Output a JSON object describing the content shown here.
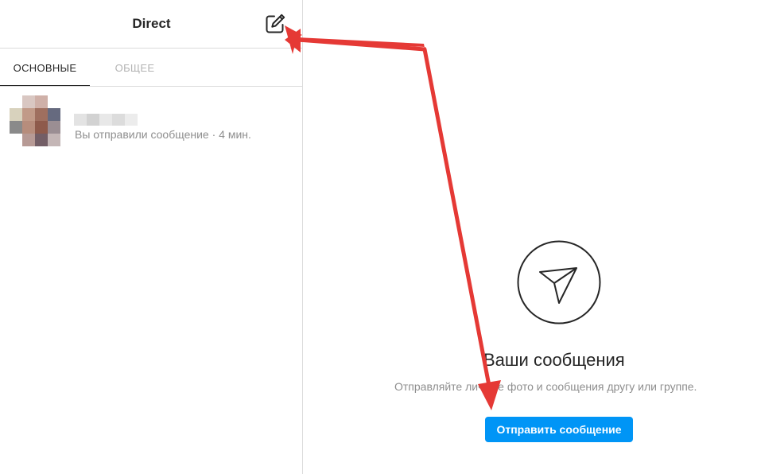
{
  "header": {
    "title": "Direct",
    "compose_icon": "new-message-icon"
  },
  "tabs": [
    {
      "label": "ОСНОВНЫЕ",
      "active": true
    },
    {
      "label": "ОБЩЕЕ",
      "active": false
    }
  ],
  "threads": [
    {
      "preview": "Вы отправили сообщение · 4 мин."
    }
  ],
  "empty_state": {
    "icon": "paper-plane-icon",
    "title": "Ваши сообщения",
    "subtitle": "Отправляйте личные фото и сообщения другу или группе.",
    "button_label": "Отправить сообщение"
  },
  "colors": {
    "accent": "#0095f6",
    "annotation_arrow": "#e53935",
    "border": "#dbdbdb",
    "muted_text": "#8e8e8e"
  }
}
